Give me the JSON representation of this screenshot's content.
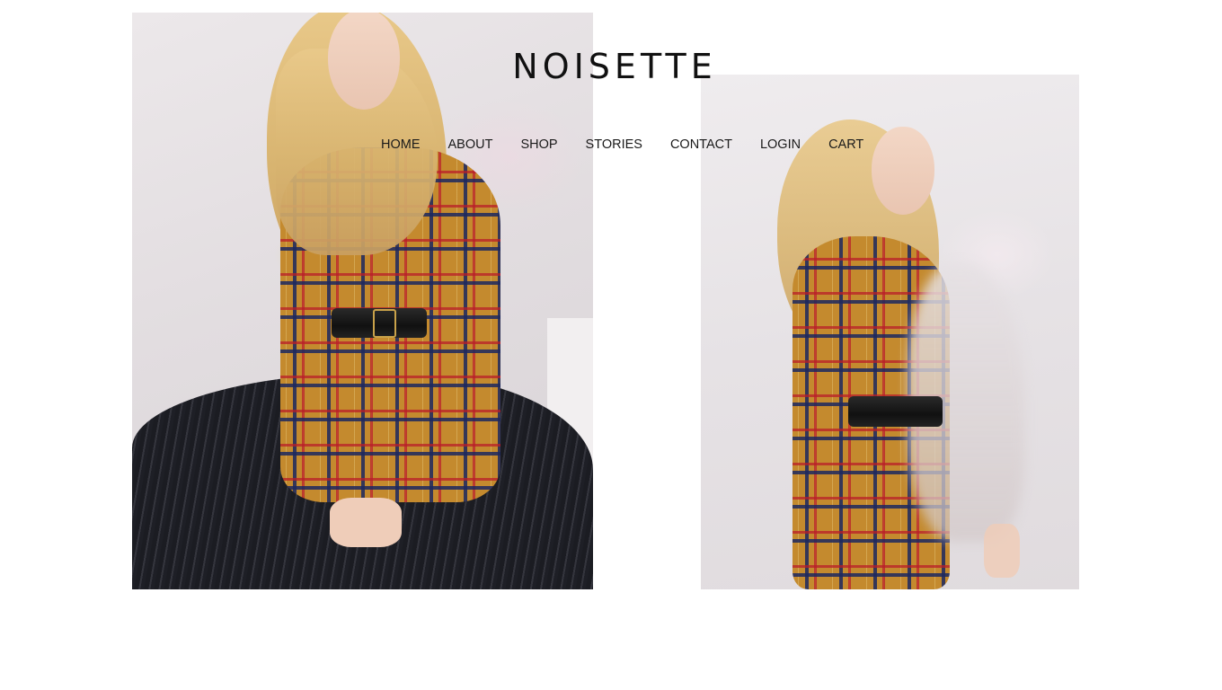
{
  "brand": {
    "logo_text": "NOISETTE",
    "color": "#111111"
  },
  "nav": {
    "items": [
      {
        "label": "HOME"
      },
      {
        "label": "ABOUT"
      },
      {
        "label": "SHOP"
      },
      {
        "label": "STORIES"
      },
      {
        "label": "CONTACT"
      },
      {
        "label": "LOGIN"
      },
      {
        "label": "CART"
      }
    ]
  },
  "hero": {
    "images": [
      {
        "subject": "model-seated-plaid-shirt-pleated-trousers"
      },
      {
        "subject": "model-standing-plaid-shirt-motion-blur"
      }
    ]
  }
}
